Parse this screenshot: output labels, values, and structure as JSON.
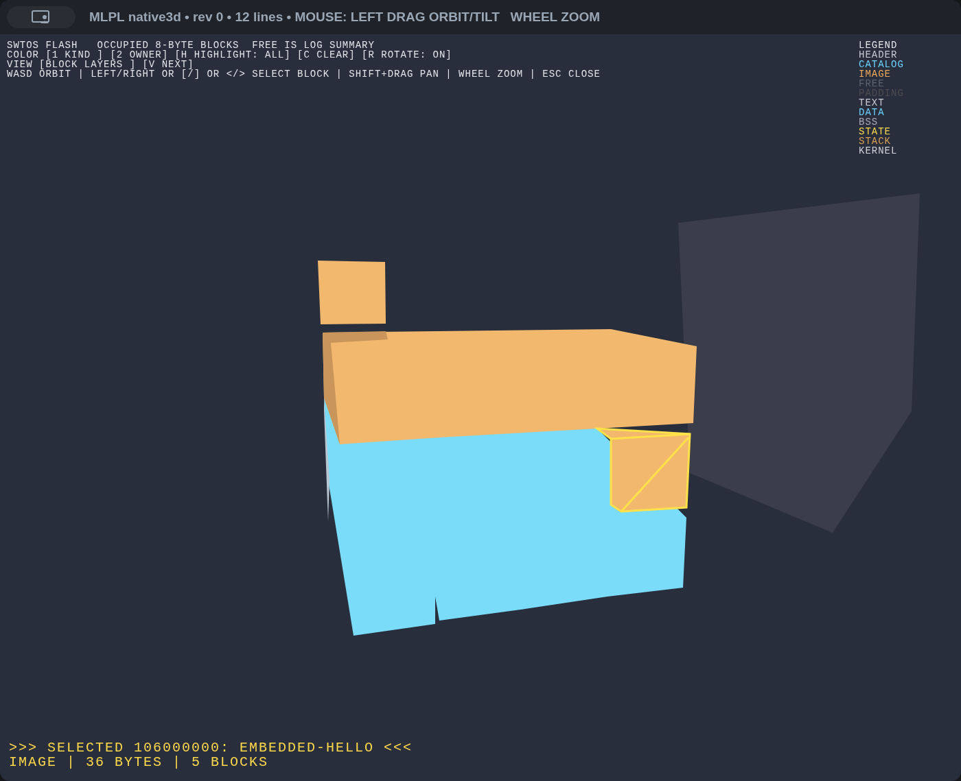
{
  "window": {
    "title": "MLPL native3d • rev 0 • 12 lines • MOUSE: LEFT DRAG ORBIT/TILT   WHEEL ZOOM"
  },
  "help_lines": [
    "SWTOS FLASH   OCCUPIED 8-BYTE BLOCKS  FREE IS LOG SUMMARY",
    "COLOR [1 KIND ] [2 OWNER] [H HIGHLIGHT: ALL] [C CLEAR] [R ROTATE: ON]",
    "VIEW [BLOCK LAYERS ] [V NEXT]",
    "WASD ORBIT | LEFT/RIGHT OR [/] OR </> SELECT BLOCK | SHIFT+DRAG PAN | WHEEL ZOOM | ESC CLOSE"
  ],
  "legend": {
    "title": "LEGEND",
    "items": [
      {
        "label": "HEADER",
        "color": "#c8ccd2"
      },
      {
        "label": "CATALOG",
        "color": "#6dd3ff"
      },
      {
        "label": "IMAGE",
        "color": "#f0a85a"
      },
      {
        "label": "FREE",
        "color": "#5e6370"
      },
      {
        "label": "PADDING",
        "color": "#4e4c50"
      },
      {
        "label": "TEXT",
        "color": "#c8ccd2"
      },
      {
        "label": "DATA",
        "color": "#6dd3ff"
      },
      {
        "label": "BSS",
        "color": "#a6abb3"
      },
      {
        "label": "STATE",
        "color": "#ffd84a"
      },
      {
        "label": "STACK",
        "color": "#d9a050"
      },
      {
        "label": "KERNEL",
        "color": "#d0d3d8"
      }
    ]
  },
  "selection": {
    "lines": [
      ">>> SELECTED 106000000: EMBEDDED-HELLO <<<",
      "IMAGE | 36 BYTES | 5 BLOCKS"
    ]
  }
}
